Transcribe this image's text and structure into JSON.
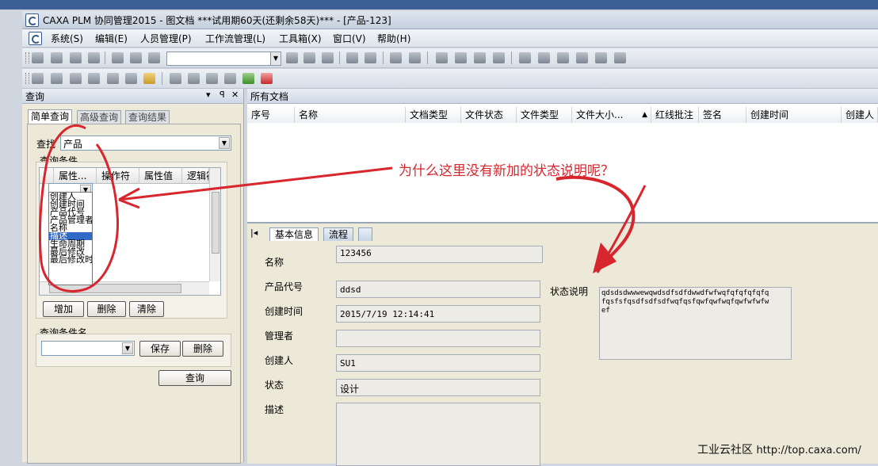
{
  "window": {
    "title": "CAXA PLM 协同管理2015 - 图文档   ***试用期60天(还剩余58天)*** - [产品-123]"
  },
  "menu": [
    "系统(S)",
    "编辑(E)",
    "人员管理(P)",
    "工作流管理(L)",
    "工具箱(X)",
    "窗口(V)",
    "帮助(H)"
  ],
  "query_pane": {
    "title": "查询",
    "header_buttons": [
      "▾",
      "ꟼ",
      "✕"
    ],
    "tabs": [
      "简单查询",
      "高级查询",
      "查询结果"
    ],
    "find_label": "查找",
    "find_value": "产品",
    "conditions_label": "查询条件",
    "grid_headers": [
      "属性...",
      "操作符",
      "属性值",
      "逻辑符"
    ],
    "dropdown_items": [
      "创建人",
      "创建时间",
      "产品代号",
      "产品管理者",
      "名称",
      "描述",
      "生命周期",
      "最后修改",
      "最后修改时"
    ],
    "dropdown_selected": "描述",
    "buttons": {
      "add": "增加",
      "delete": "删除",
      "clear": "清除"
    },
    "cond_name_label": "查询条件名",
    "save": "保存",
    "delete2": "删除",
    "query": "查询"
  },
  "docs_pane": {
    "title": "所有文档",
    "columns": [
      "序号",
      "名称",
      "文档类型",
      "文件状态",
      "文件类型",
      "文件大小...",
      "红线批注",
      "签名",
      "创建时间",
      "创建人"
    ]
  },
  "detail": {
    "tabs": [
      "基本信息",
      "流程"
    ],
    "fields": [
      {
        "label": "名称",
        "value": "123456"
      },
      {
        "label": "产品代号",
        "value": "ddsd"
      },
      {
        "label": "创建时间",
        "value": "2015/7/19 12:14:41"
      },
      {
        "label": "管理者",
        "value": ""
      },
      {
        "label": "创建人",
        "value": "SU1"
      },
      {
        "label": "状态",
        "value": "设计"
      },
      {
        "label": "描述",
        "value": ""
      }
    ],
    "status_note_label": "状态说明",
    "status_note_lines": [
      "qdsdsdwwwewqwdsdfsdfdwwdfwfwqfqfqfqfqfq",
      "fqsfsfqsdfsdfsdfwqfqsfqwfqwfwqfqwfwfwfw",
      "ef"
    ]
  },
  "annotation": "为什么这里没有新加的状态说明呢？",
  "footer": {
    "site": "工业云社区",
    "url": "http://top.caxa.com/"
  },
  "colors": {
    "annotation_red": "#d8262e",
    "title_blue": "#3d5f97"
  }
}
